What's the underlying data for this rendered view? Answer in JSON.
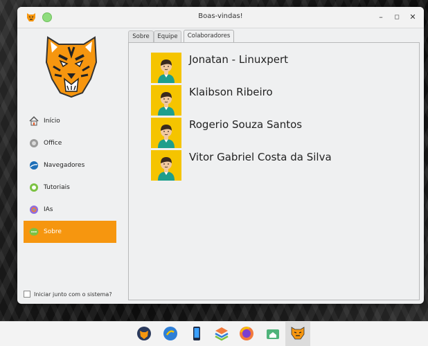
{
  "window": {
    "title": "Boas-vindas!",
    "minimize_glyph": "–",
    "maximize_glyph": "◻",
    "close_glyph": "✕"
  },
  "sidebar": {
    "items": [
      {
        "label": "Início",
        "icon": "home-icon"
      },
      {
        "label": "Office",
        "icon": "office-icon"
      },
      {
        "label": "Navegadores",
        "icon": "browser-icon"
      },
      {
        "label": "Tutoriais",
        "icon": "tutorials-icon"
      },
      {
        "label": "IAs",
        "icon": "ai-icon"
      },
      {
        "label": "Sobre",
        "icon": "chat-icon",
        "active": true
      }
    ],
    "autostart_label": "Iniciar junto com o sistema?",
    "autostart_checked": false
  },
  "tabs": [
    {
      "label": "Sobre"
    },
    {
      "label": "Equipe"
    },
    {
      "label": "Colaboradores",
      "active": true
    }
  ],
  "collaborators": [
    {
      "name": "Jonatan - Linuxpert"
    },
    {
      "name": "Klaibson Ribeiro"
    },
    {
      "name": "Rogerio Souza Santos"
    },
    {
      "name": "Vitor Gabriel Costa da Silva"
    }
  ],
  "colors": {
    "accent": "#f6960f",
    "avatar_bg": "#f5c400",
    "avatar_shirt": "#1e9e8c"
  },
  "taskbar": {
    "apps": [
      "tiger-app-icon",
      "files-icon",
      "phone-icon",
      "layers-icon",
      "firefox-icon",
      "store-icon",
      "welcome-tiger-icon"
    ]
  }
}
